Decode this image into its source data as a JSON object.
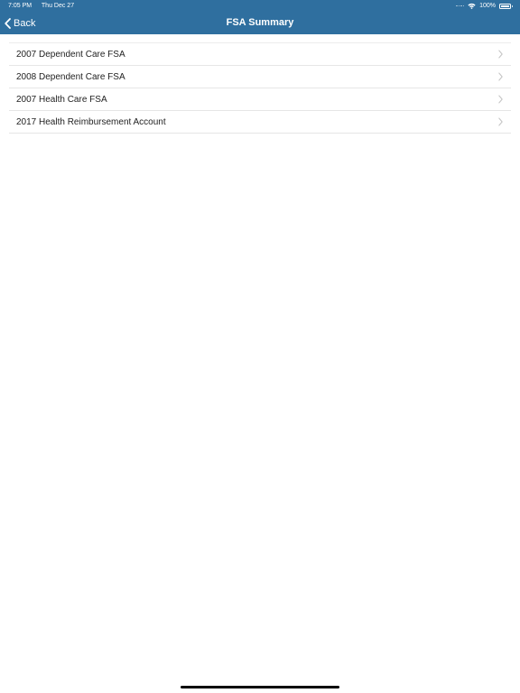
{
  "status_bar": {
    "time": "7:05 PM",
    "date": "Thu Dec 27",
    "battery": "100%",
    "battery_level": 1.0,
    "icons": [
      "signal-icon",
      "wifi-icon",
      "battery-icon"
    ]
  },
  "nav": {
    "back_label": "Back",
    "title": "FSA Summary",
    "background_color": "#2f6f9f"
  },
  "accounts": [
    {
      "label": "2007 Dependent Care FSA"
    },
    {
      "label": "2008 Dependent Care FSA"
    },
    {
      "label": "2007 Health Care FSA"
    },
    {
      "label": "2017 Health Reimbursement Account"
    }
  ]
}
